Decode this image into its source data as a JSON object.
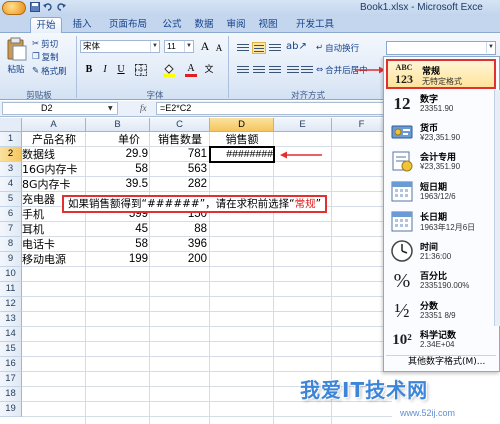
{
  "window": {
    "title": "Book1.xlsx - Microsoft Exce"
  },
  "tabs": [
    "开始",
    "插入",
    "页面布局",
    "公式",
    "数据",
    "审阅",
    "视图",
    "开发工具"
  ],
  "ribbon": {
    "paste_label": "粘贴",
    "cut_label": "剪切",
    "copy_label": "复制",
    "format_painter_label": "格式刷",
    "font_name": "宋体",
    "font_size": "11",
    "wrap_text_label": "自动换行",
    "merge_label": "合并后居中",
    "group_clipboard": "剪贴板",
    "group_font": "字体",
    "group_alignment": "对齐方式",
    "bold": "B",
    "italic": "I",
    "underline": "U",
    "font_color_glyph": "A",
    "grow_font": "A",
    "shrink_font": "A"
  },
  "formula_bar": {
    "name_box": "D2",
    "fx": "fx",
    "formula": "=E2*C2"
  },
  "sheet": {
    "columns": [
      "A",
      "B",
      "C",
      "D",
      "E",
      "F"
    ],
    "rows": [
      "1",
      "2",
      "3",
      "4",
      "5",
      "6",
      "7",
      "8",
      "9",
      "10",
      "11",
      "12",
      "13",
      "14",
      "15",
      "16",
      "17",
      "18",
      "19"
    ],
    "headers": {
      "A": "产品名称",
      "B": "单价",
      "C": "销售数量",
      "D": "销售额"
    },
    "data": [
      {
        "name": "数据线",
        "price": "29.9",
        "qty": "781",
        "sales": "########"
      },
      {
        "name": "16G内存卡",
        "price": "58",
        "qty": "563",
        "sales": ""
      },
      {
        "name": "8G内存卡",
        "price": "39.5",
        "qty": "282",
        "sales": ""
      },
      {
        "name": "充电器",
        "price": "",
        "qty": "",
        "sales": ""
      },
      {
        "name": "手机",
        "price": "599",
        "qty": "150",
        "sales": ""
      },
      {
        "name": "耳机",
        "price": "45",
        "qty": "88",
        "sales": ""
      },
      {
        "name": "电话卡",
        "price": "58",
        "qty": "396",
        "sales": ""
      },
      {
        "name": "移动电源",
        "price": "199",
        "qty": "200",
        "sales": ""
      }
    ]
  },
  "callout": {
    "before": "如果销售额得到“######”，请在求积前选择“",
    "highlight": "常规",
    "after": "”"
  },
  "number_format_gallery": {
    "items": [
      {
        "icon": "ABC\n123",
        "title": "常规",
        "sample": "无特定格式"
      },
      {
        "icon": "12",
        "title": "数字",
        "sample": "23351.90"
      },
      {
        "icon": "currency",
        "title": "货币",
        "sample": "¥23,351.90"
      },
      {
        "icon": "accounting",
        "title": "会计专用",
        "sample": "¥23,351.90"
      },
      {
        "icon": "calendar",
        "title": "短日期",
        "sample": "1963/12/6"
      },
      {
        "icon": "calendar",
        "title": "长日期",
        "sample": "1963年12月6日"
      },
      {
        "icon": "clock",
        "title": "时间",
        "sample": "21:36:00"
      },
      {
        "icon": "%",
        "title": "百分比",
        "sample": "2335190.00%"
      },
      {
        "icon": "½",
        "title": "分数",
        "sample": "23351 8/9"
      },
      {
        "icon": "10²",
        "title": "科学记数",
        "sample": "2.34E+04"
      }
    ],
    "more_label": "其他数字格式(M)..."
  },
  "watermark": {
    "text": "我爱IT技术网",
    "url": "www.52ij.com"
  },
  "colors": {
    "accent_red": "#e03030",
    "ribbon_blue": "#15428b"
  }
}
